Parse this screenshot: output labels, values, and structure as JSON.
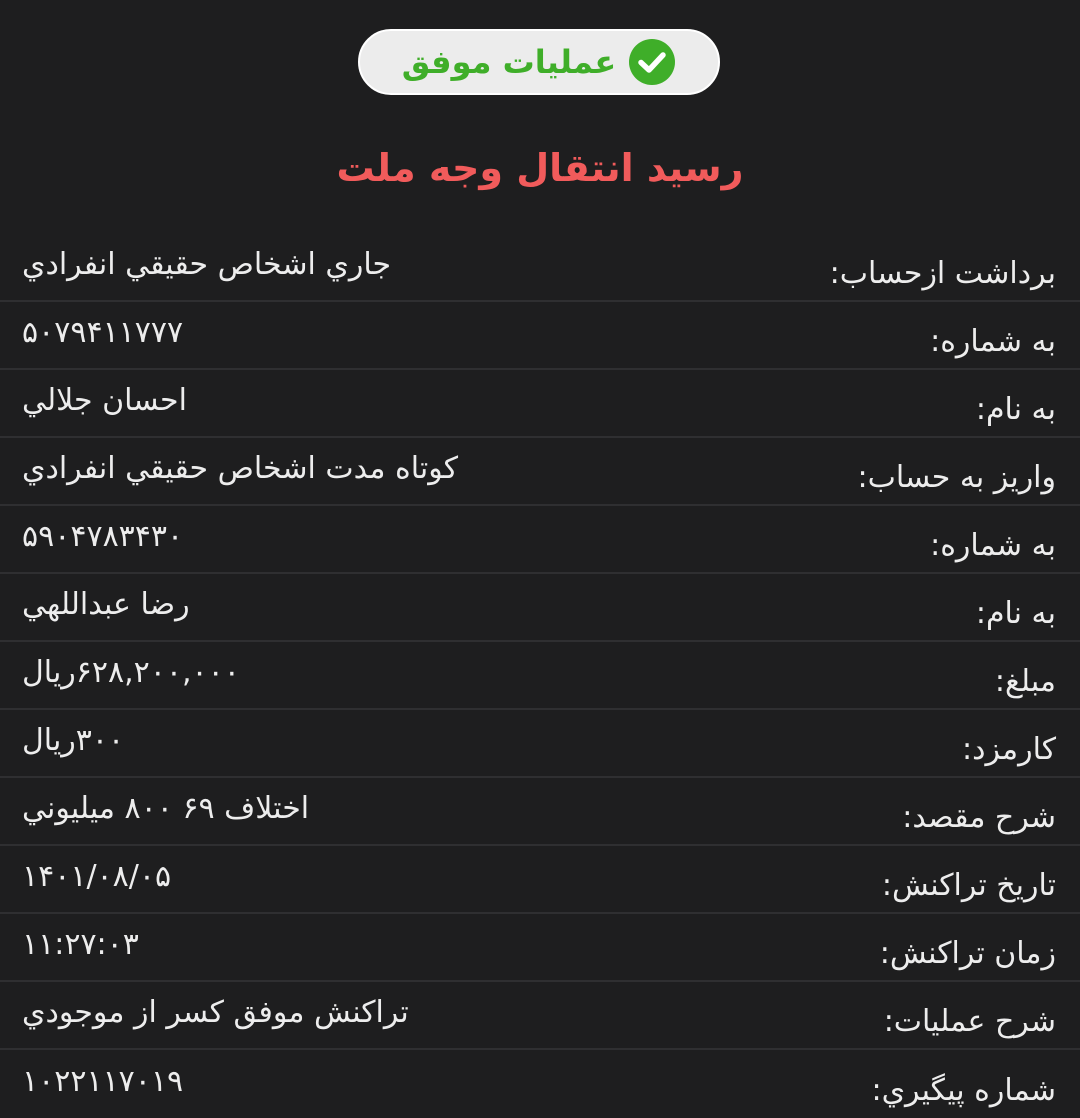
{
  "status": {
    "text": "عمليات موفق",
    "icon": "check-circle-icon",
    "color": "#3fae29"
  },
  "title": "رسيد انتقال وجه ملت",
  "title_color": "#f15b5b",
  "rows": [
    {
      "label": "برداشت ازحساب:",
      "value": "جاري اشخاص حقيقي انفرادي"
    },
    {
      "label": "به شماره:",
      "value": "۵۰۷۹۴۱۱۷۷۷"
    },
    {
      "label": "به نام:",
      "value": "احسان جلالي"
    },
    {
      "label": "واريز به حساب:",
      "value": "كوتاه مدت اشخاص حقيقي انفرادي"
    },
    {
      "label": "به شماره:",
      "value": "۵۹۰۴۷۸۳۴۳۰"
    },
    {
      "label": "به نام:",
      "value": "رضا عبداللهي"
    },
    {
      "label": "مبلغ:",
      "value": " ۶۲۸,۲۰۰,۰۰۰ريال"
    },
    {
      "label": "كارمزد:",
      "value": "۳۰۰ريال"
    },
    {
      "label": "شرح مقصد:",
      "value": "اختلاف ۶۹ ۸۰۰ ميليوني"
    },
    {
      "label": "تاريخ تراكنش:",
      "value": "۱۴۰۱/۰۸/۰۵"
    },
    {
      "label": "زمان تراكنش:",
      "value": "۱۱:۲۷:۰۳"
    },
    {
      "label": "شرح عمليات:",
      "value": "تراكنش موفق كسر از موجودي"
    },
    {
      "label": "شماره پيگيري:",
      "value": "۱۰۲۲۱۱۷۰۱۹"
    }
  ]
}
